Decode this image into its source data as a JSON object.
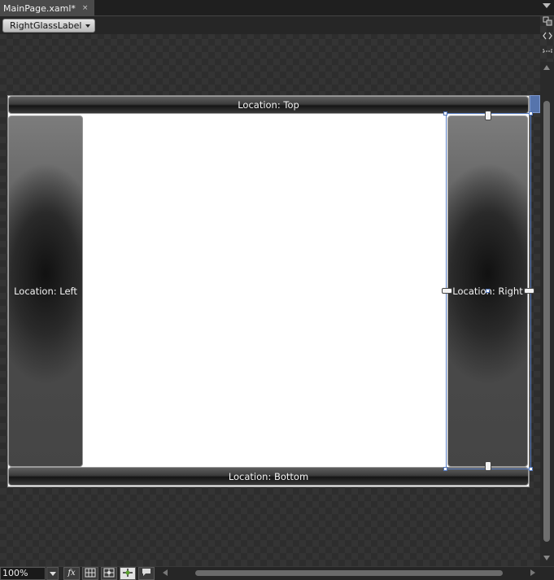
{
  "document_tab": {
    "title": "MainPage.xaml*",
    "close_glyph": "×"
  },
  "breadcrumb": {
    "element": "RightGlassLabel"
  },
  "canvas": {
    "labels": {
      "top": "Location: Top",
      "left": "Location: Left",
      "right": "Location: Right",
      "bottom": "Location: Bottom"
    },
    "selected_element": "RightGlassLabel"
  },
  "statusbar": {
    "zoom": "100%"
  },
  "icons": {
    "close": "close-icon",
    "overflow": "chevron-down-icon",
    "breadcrumb_dropdown": "chevron-down-icon",
    "fx": "fx-icon",
    "grid": "grid-icon",
    "snap_grid": "snap-grid-icon",
    "snap_lines": "snap-lines-icon",
    "annotation": "annotation-icon"
  }
}
